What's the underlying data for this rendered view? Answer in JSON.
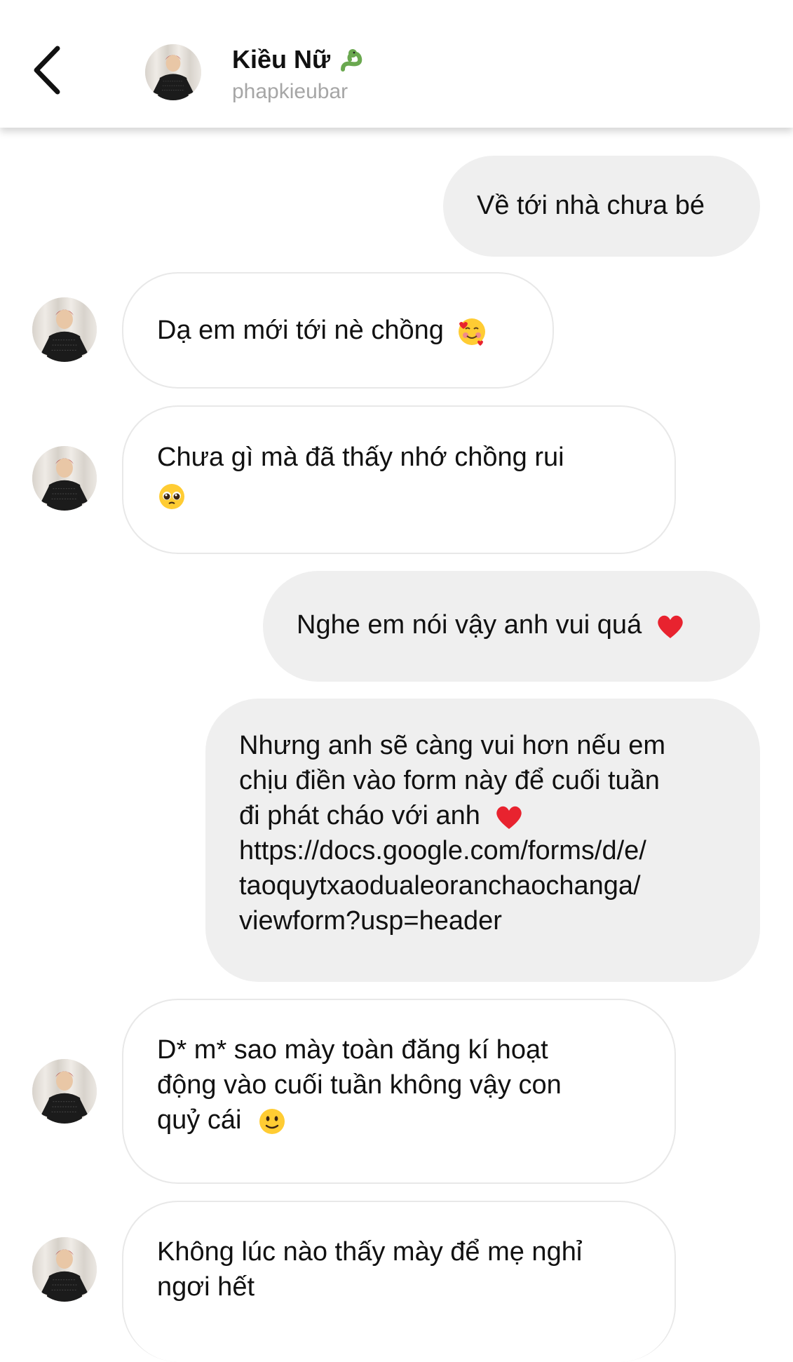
{
  "header": {
    "contact_name": "Kiều Nữ",
    "username": "phapkieubar",
    "name_emoji": "snake-emoji"
  },
  "messages": [
    {
      "direction": "out",
      "text": "Về tới nhà chưa bé"
    },
    {
      "direction": "in",
      "text": "Dạ em mới tới nè chồng",
      "emoji": "smiling-face-with-hearts"
    },
    {
      "direction": "in",
      "text": "Chưa gì mà đã thấy nhớ chồng rui",
      "emoji": "pleading-face"
    },
    {
      "direction": "out",
      "text": "Nghe em nói vậy anh vui quá",
      "emoji": "red-heart"
    },
    {
      "direction": "out",
      "text": "Nhưng anh sẽ càng vui hơn nếu em\nchịu điền vào form này để cuối tuần\nđi phát cháo với anh",
      "emoji": "red-heart",
      "link": "https://docs.google.com/forms/d/e/\ntaoquytxaodualeoranchaochanga/\nviewform?usp=header"
    },
    {
      "direction": "in",
      "text": "D* m* sao mày toàn đăng kí hoạt\nđộng vào cuối tuần không vậy con\nquỷ cái",
      "emoji": "slightly-smiling-face"
    },
    {
      "direction": "in",
      "text": "Không lúc nào thấy mày để mẹ nghỉ\nngơi hết"
    }
  ],
  "colors": {
    "outgoing_bubble": "#efefef",
    "incoming_border": "#e8e8e8",
    "username_gray": "#a6a6a6",
    "heart_red": "#e8232f"
  }
}
